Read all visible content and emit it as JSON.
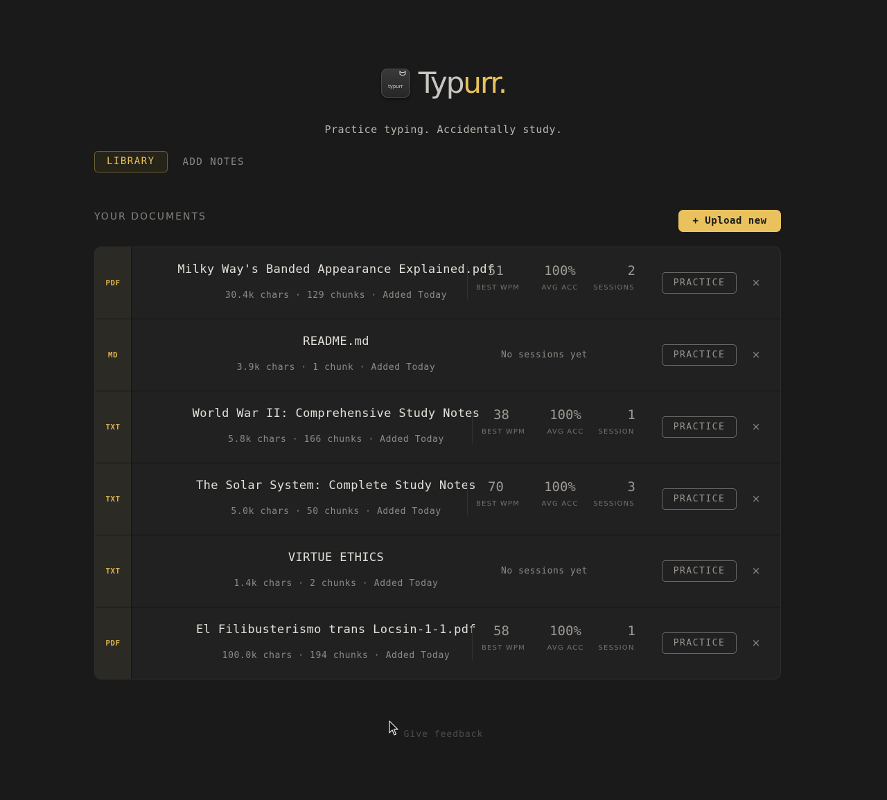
{
  "brand": {
    "logo_text": "typurr",
    "name_part1": "Typ",
    "name_part2": "urr.",
    "tagline": "Practice typing. Accidentally study."
  },
  "tabs": [
    {
      "label": "LIBRARY",
      "active": true
    },
    {
      "label": "ADD NOTES",
      "active": false
    }
  ],
  "section": {
    "title": "YOUR DOCUMENTS",
    "upload_label": "+ Upload new"
  },
  "documents": [
    {
      "type": "PDF",
      "title": "Milky Way's Banded Appearance Explained.pdf",
      "meta": "30.4k chars · 129 chunks · Added Today",
      "has_stats": true,
      "best_wpm": "51",
      "best_wpm_label": "BEST WPM",
      "avg_acc": "100%",
      "avg_acc_label": "AVG ACC",
      "sessions": "2",
      "sessions_label": "SESSIONS",
      "no_sessions_text": "",
      "practice_label": "PRACTICE",
      "delete_label": "×"
    },
    {
      "type": "MD",
      "title": "README.md",
      "meta": "3.9k chars · 1 chunk · Added Today",
      "has_stats": false,
      "best_wpm": "",
      "best_wpm_label": "",
      "avg_acc": "",
      "avg_acc_label": "",
      "sessions": "",
      "sessions_label": "",
      "no_sessions_text": "No sessions yet",
      "practice_label": "PRACTICE",
      "delete_label": "×"
    },
    {
      "type": "TXT",
      "title": "World War II: Comprehensive Study Notes",
      "meta": "5.8k chars · 166 chunks · Added Today",
      "has_stats": true,
      "best_wpm": "38",
      "best_wpm_label": "BEST WPM",
      "avg_acc": "100%",
      "avg_acc_label": "AVG ACC",
      "sessions": "1",
      "sessions_label": "SESSION",
      "no_sessions_text": "",
      "practice_label": "PRACTICE",
      "delete_label": "×"
    },
    {
      "type": "TXT",
      "title": "The Solar System: Complete Study Notes",
      "meta": "5.0k chars · 50 chunks · Added Today",
      "has_stats": true,
      "best_wpm": "70",
      "best_wpm_label": "BEST WPM",
      "avg_acc": "100%",
      "avg_acc_label": "AVG ACC",
      "sessions": "3",
      "sessions_label": "SESSIONS",
      "no_sessions_text": "",
      "practice_label": "PRACTICE",
      "delete_label": "×"
    },
    {
      "type": "TXT",
      "title": "VIRTUE ETHICS",
      "meta": "1.4k chars · 2 chunks · Added Today",
      "has_stats": false,
      "best_wpm": "",
      "best_wpm_label": "",
      "avg_acc": "",
      "avg_acc_label": "",
      "sessions": "",
      "sessions_label": "",
      "no_sessions_text": "No sessions yet",
      "practice_label": "PRACTICE",
      "delete_label": "×"
    },
    {
      "type": "PDF",
      "title": "El Filibusterismo trans Locsin-1-1.pdf",
      "meta": "100.0k chars · 194 chunks · Added Today",
      "has_stats": true,
      "best_wpm": "58",
      "best_wpm_label": "BEST WPM",
      "avg_acc": "100%",
      "avg_acc_label": "AVG ACC",
      "sessions": "1",
      "sessions_label": "SESSION",
      "no_sessions_text": "",
      "practice_label": "PRACTICE",
      "delete_label": "×"
    }
  ],
  "footer": {
    "feedback_label": "Give feedback"
  },
  "colors": {
    "background": "#1b1a1a",
    "accent": "#eac25d",
    "row_background": "#222121",
    "type_column": "#2c2a24"
  }
}
